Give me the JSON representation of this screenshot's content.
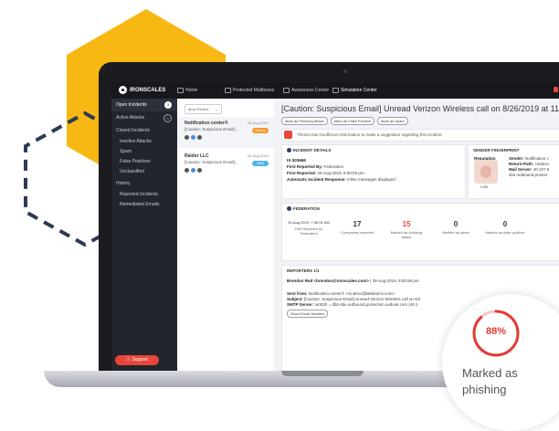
{
  "app": {
    "brand": "IRONSCALES",
    "nav": [
      "Home",
      "Protected Mailboxes",
      "Awareness Center",
      "Simulation Center"
    ]
  },
  "sidebar": {
    "items": [
      {
        "label": "Open Incidents",
        "badge": "3"
      },
      {
        "label": "Active Attacks",
        "badge": "0"
      },
      {
        "label": "Closed Incidents"
      },
      {
        "label": "Inactive Attacks"
      },
      {
        "label": "Spam"
      },
      {
        "label": "False Positives"
      },
      {
        "label": "Unclassified"
      },
      {
        "label": "History"
      },
      {
        "label": "Reported Incidents"
      },
      {
        "label": "Remediated Emails"
      }
    ],
    "support": "Support"
  },
  "incident_list": {
    "sort": "Most Recent",
    "items": [
      {
        "sender": "Notification center®",
        "date": "26-Aug-2019",
        "subject": "[Caution: Suspicious Email]...",
        "tag": "Verizon"
      },
      {
        "sender": "Raider LLC",
        "date": "26-Aug-2019",
        "subject": "[Caution: Suspicious Email]...",
        "tag": "AWS"
      }
    ]
  },
  "incident": {
    "title": "[Caution: Suspicious Email] Unread Verizon Wireless call on 8/26/2019 at 11:00 P",
    "actions": [
      "Mark as Phishing Attack",
      "Mark as False Positive",
      "Mark as Spam"
    ],
    "suggestion": "Themis has insufficient information to make a suggestion regarding this incident",
    "details": {
      "header": "INCIDENT DETAILS",
      "id": "IS-303668",
      "reported_by_label": "First Reported By:",
      "reported_by": "Federation",
      "reported_label": "First Reported:",
      "reported": "26-Aug-2019, 6:00:08 pm",
      "auto_label": "Automatic Incident Response:",
      "auto": "Inline messages displayed"
    },
    "fingerprint": {
      "header": "SENDER FINGERPRINT",
      "reputation_label": "Reputation",
      "sender_label": "Sender:",
      "sender": "Notification c",
      "return_label": "Return-Path:",
      "return": "cindexo",
      "mail_label": "Mail Server:",
      "mail": "40.107.6",
      "mail2": "sbe.outbound.protect",
      "badge": "LOW"
    },
    "federation": {
      "header": "FEDERATION",
      "date": "20-Aug-2019, 7:38:01 AM",
      "date_caption": "First Reported by Federation",
      "stats": [
        {
          "value": "17",
          "label": "Companies reported"
        },
        {
          "value": "15",
          "label": "Marked as phishing attack"
        },
        {
          "value": "0",
          "label": "Marked as spam"
        },
        {
          "value": "0",
          "label": "Marked as false positive"
        }
      ]
    },
    "reporters": {
      "header": "REPORTERS 1/1",
      "name": "Brendon Red <brendon@ironscales.com>",
      "time": "| 28-Aug-2019, 6:00:58 pm",
      "sent_label": "Sent from:",
      "sent": "Notification center® <cindexo@lakkiral-ki.com>",
      "subject_label": "Subject:",
      "subject": "[Caution: Suspicious Email] Unread Verizon Wireless call on 8/2",
      "smtp_label": "SMTP Server:",
      "smtp": "\\u0020 = db0-sbe.outbound.protection.outlook.com (40.1",
      "button": "Show Email Headers"
    }
  },
  "overlay": {
    "percent": "88%",
    "percent_value": 0.88,
    "line1": "Marked as",
    "line2": "phishing"
  },
  "colors": {
    "accent_red": "#e23b34",
    "hex_yellow": "#f7b813",
    "hex_dash": "#2d3a55",
    "tag_orange": "#f59a2a",
    "tag_blue": "#4fb3e8"
  }
}
